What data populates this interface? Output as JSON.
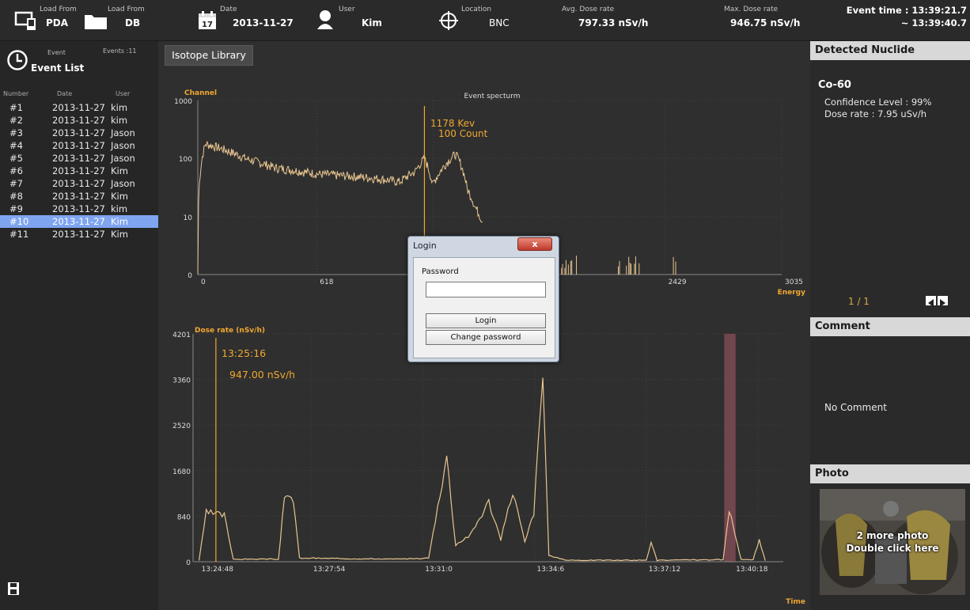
{
  "toolbar": {
    "load_pda_top": "Load From",
    "load_pda_bottom": "PDA",
    "load_db_top": "Load From",
    "load_db_bottom": "DB",
    "date_label": "Date",
    "date_icon_day": "17",
    "date_value": "2013-11-27",
    "user_label": "User",
    "user_value": "Kim",
    "location_label": "Location",
    "location_value": "BNC",
    "avg_label": "Avg. Dose rate",
    "avg_value": "797.33 nSv/h",
    "max_label": "Max. Dose rate",
    "max_value": "946.75 nSv/h",
    "event_time_line1": "Event time : 13:39:21.7",
    "event_time_line2": "~ 13:39:40.7"
  },
  "event_panel": {
    "small_label": "Event",
    "count_label": "Events :11",
    "title": "Event List",
    "columns": [
      "Number",
      "Date",
      "User"
    ],
    "rows": [
      {
        "num": "#1",
        "date": "2013-11-27",
        "user": "kim"
      },
      {
        "num": "#2",
        "date": "2013-11-27",
        "user": "kim"
      },
      {
        "num": "#3",
        "date": "2013-11-27",
        "user": "Jason"
      },
      {
        "num": "#4",
        "date": "2013-11-27",
        "user": "Jason"
      },
      {
        "num": "#5",
        "date": "2013-11-27",
        "user": "Jason"
      },
      {
        "num": "#6",
        "date": "2013-11-27",
        "user": "Kim"
      },
      {
        "num": "#7",
        "date": "2013-11-27",
        "user": "Jason"
      },
      {
        "num": "#8",
        "date": "2013-11-27",
        "user": "Kim"
      },
      {
        "num": "#9",
        "date": "2013-11-27",
        "user": "kim"
      },
      {
        "num": "#10",
        "date": "2013-11-27",
        "user": "Kim"
      },
      {
        "num": "#11",
        "date": "2013-11-27",
        "user": "Kim"
      }
    ],
    "selected_index": 9
  },
  "main": {
    "library_button": "Isotope Library"
  },
  "spectrum": {
    "title": "Event specturm",
    "ylabel": "Channel",
    "xlabel": "Energy",
    "yticks": [
      "1000",
      "100",
      "10",
      "0"
    ],
    "xticks": [
      "0",
      "618",
      "1224",
      "2429",
      "3035"
    ],
    "marker_energy": "1178 Kev",
    "marker_count": "100 Count"
  },
  "doserate": {
    "ylabel": "Dose rate (nSv/h)",
    "xlabel": "Time",
    "yticks": [
      "4201",
      "3360",
      "2520",
      "1680",
      "840",
      "0"
    ],
    "xticks": [
      "13:24:48",
      "13:27:54",
      "13:31:0",
      "13:34:6",
      "13:37:12",
      "13:40:18"
    ],
    "marker_time": "13:25:16",
    "marker_value": "947.00 nSv/h"
  },
  "chart_data": [
    {
      "type": "line",
      "title": "Event specturm",
      "ylabel": "Channel",
      "xlabel": "Energy",
      "xlim": [
        0,
        3035
      ],
      "y_scale": "log",
      "ylim": [
        0,
        1000
      ],
      "x": [
        0,
        40,
        120,
        250,
        400,
        618,
        800,
        950,
        1050,
        1130,
        1178,
        1220,
        1260,
        1340,
        1400,
        1440,
        1480
      ],
      "y": [
        0,
        180,
        150,
        100,
        70,
        55,
        50,
        45,
        40,
        60,
        100,
        35,
        60,
        120,
        30,
        15,
        8
      ],
      "marker": {
        "energy_kev": 1178,
        "count": 100
      }
    },
    {
      "type": "line",
      "ylabel": "Dose rate (nSv/h)",
      "xlabel": "Time",
      "x_ticks": [
        "13:24:48",
        "13:27:54",
        "13:31:0",
        "13:34:6",
        "13:37:12",
        "13:40:18"
      ],
      "ylim": [
        0,
        4201
      ],
      "series": [
        {
          "points": [
            [
              "13:24:48",
              20
            ],
            [
              "13:25:0",
              900
            ],
            [
              "13:25:30",
              850
            ],
            [
              "13:25:45",
              40
            ],
            [
              "13:27:0",
              40
            ],
            [
              "13:27:10",
              1150
            ],
            [
              "13:27:25",
              1150
            ],
            [
              "13:27:35",
              60
            ],
            [
              "13:30:30",
              40
            ],
            [
              "13:31:10",
              60
            ],
            [
              "13:31:40",
              1950
            ],
            [
              "13:31:55",
              300
            ],
            [
              "13:32:20",
              500
            ],
            [
              "13:32:50",
              1100
            ],
            [
              "13:33:10",
              400
            ],
            [
              "13:33:30",
              1300
            ],
            [
              "13:33:50",
              350
            ],
            [
              "13:34:5",
              900
            ],
            [
              "13:34:20",
              3450
            ],
            [
              "13:34:30",
              100
            ],
            [
              "13:35:0",
              20
            ],
            [
              "13:37:12",
              20
            ],
            [
              "13:37:20",
              350
            ],
            [
              "13:37:30",
              20
            ],
            [
              "13:39:20",
              30
            ],
            [
              "13:39:30",
              950
            ],
            [
              "13:39:40",
              450
            ],
            [
              "13:39:50",
              30
            ],
            [
              "13:40:10",
              30
            ],
            [
              "13:40:20",
              400
            ],
            [
              "13:40:30",
              20
            ]
          ]
        }
      ],
      "highlight_range": [
        "13:39:21.7",
        "13:39:40.7"
      ],
      "marker": {
        "time": "13:25:16",
        "value": 947.0
      }
    }
  ],
  "right_panel": {
    "detected_header": "Detected Nuclide",
    "nuclide": "Co-60",
    "confidence": "Confidence Level : 99%",
    "dose_rate": "Dose rate : 7.95 uSv/h",
    "pager": "1 / 1",
    "comment_header": "Comment",
    "comment": "No Comment",
    "photo_header": "Photo",
    "photo_line1": "2 more photo",
    "photo_line2": "Double click here"
  },
  "login_dialog": {
    "title": "Login",
    "close": "x",
    "password_label": "Password",
    "password_value": "",
    "login_button": "Login",
    "change_button": "Change password"
  },
  "colors": {
    "accent": "#f0a830",
    "trace": "#e8c590",
    "selection": "#7fa4f0",
    "highlight_band": "#8a4f5a"
  }
}
